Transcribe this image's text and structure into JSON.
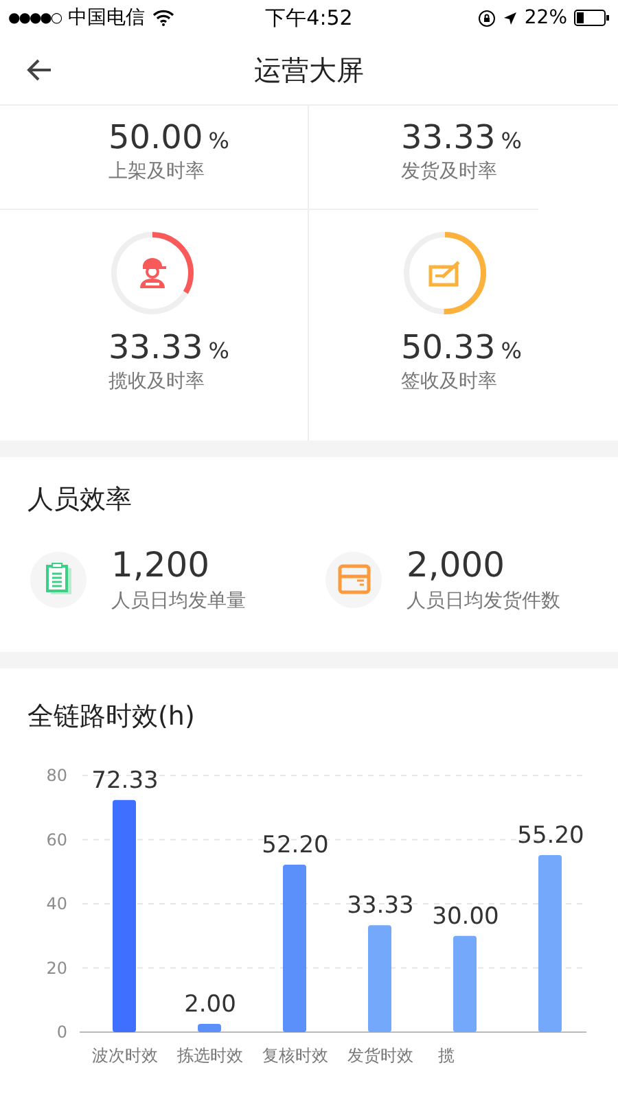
{
  "status_bar": {
    "signal": "●●●●○",
    "carrier": "中国电信",
    "time": "下午4:52",
    "battery": "22%"
  },
  "nav": {
    "title": "运营大屏"
  },
  "rates": [
    {
      "kind": "plain",
      "value": "50.00",
      "unit": "%",
      "label": "上架及时率"
    },
    {
      "kind": "plain",
      "value": "33.33",
      "unit": "%",
      "label": "发货及时率"
    },
    {
      "kind": "ring",
      "color": "#f85959",
      "value": "33.33",
      "unit": "%",
      "label": "揽收及时率"
    },
    {
      "kind": "ring",
      "color": "#fbb13c",
      "value": "50.33",
      "unit": "%",
      "label": "签收及时率"
    }
  ],
  "efficiency": {
    "title": "人员效率",
    "items": [
      {
        "value": "1,200",
        "label": "人员日均发单量"
      },
      {
        "value": "2,000",
        "label": "人员日均发货件数"
      }
    ]
  },
  "timeliness": {
    "title": "全链路时效(h)",
    "chart_data": {
      "type": "bar",
      "categories": [
        "波次时效",
        "拣选时效",
        "复核时效",
        "发货时效",
        "揽",
        null
      ],
      "series": [
        {
          "colors": [
            "#3f6ffe",
            "#5b8ff9",
            "#5b8ff9",
            "#74a8fb",
            "#74a8fb",
            "#74a8fb"
          ],
          "values": [
            72.33,
            2.0,
            52.2,
            33.33,
            30.0,
            55.2
          ]
        }
      ],
      "ylim": [
        0,
        80
      ],
      "yticks": [
        0,
        20,
        40,
        60,
        80
      ],
      "grid": true,
      "value_labels": [
        "72.33",
        "2.00",
        "52.20",
        "33.33",
        "30.00",
        "55.20"
      ]
    }
  }
}
